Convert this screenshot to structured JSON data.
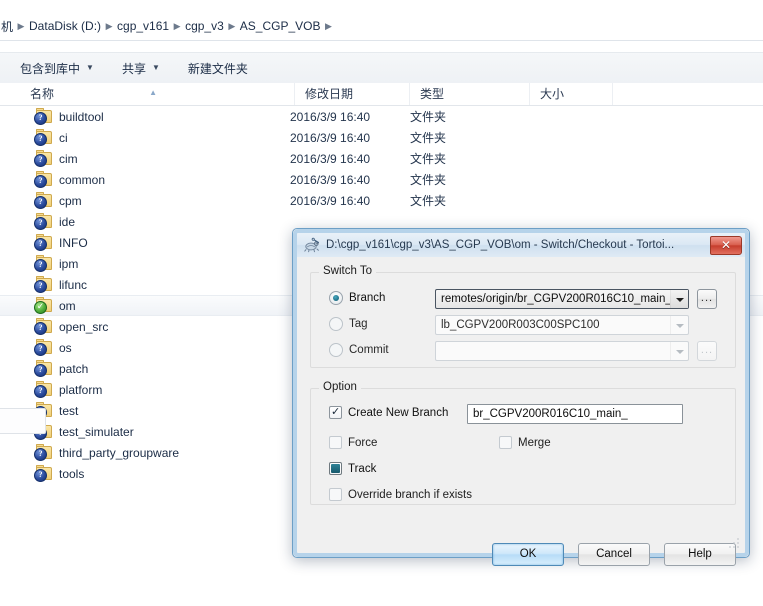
{
  "explorer": {
    "breadcrumb": {
      "items": [
        "机",
        "DataDisk (D:)",
        "cgp_v161",
        "cgp_v3",
        "AS_CGP_VOB"
      ],
      "separator": "▶"
    },
    "toolbar": {
      "items": [
        {
          "label": "包含到库中",
          "caret": "▼"
        },
        {
          "label": "共享",
          "caret": "▼"
        },
        {
          "label": "新建文件夹",
          "caret": ""
        }
      ]
    },
    "columns": [
      {
        "label": "名称",
        "sorted": "▲"
      },
      {
        "label": "修改日期",
        "sorted": ""
      },
      {
        "label": "类型",
        "sorted": ""
      },
      {
        "label": "大小",
        "sorted": ""
      }
    ],
    "rows": [
      {
        "name": "buildtool",
        "date": "2016/3/9 16:40",
        "type": "文件夹",
        "size": "",
        "overlay": "?",
        "selected": false
      },
      {
        "name": "ci",
        "date": "2016/3/9 16:40",
        "type": "文件夹",
        "size": "",
        "overlay": "?",
        "selected": false
      },
      {
        "name": "cim",
        "date": "2016/3/9 16:40",
        "type": "文件夹",
        "size": "",
        "overlay": "?",
        "selected": false
      },
      {
        "name": "common",
        "date": "2016/3/9 16:40",
        "type": "文件夹",
        "size": "",
        "overlay": "?",
        "selected": false
      },
      {
        "name": "cpm",
        "date": "2016/3/9 16:40",
        "type": "文件夹",
        "size": "",
        "overlay": "?",
        "selected": false
      },
      {
        "name": "ide",
        "date": "",
        "type": "",
        "size": "",
        "overlay": "?",
        "selected": false
      },
      {
        "name": "INFO",
        "date": "",
        "type": "",
        "size": "",
        "overlay": "?",
        "selected": false
      },
      {
        "name": "ipm",
        "date": "",
        "type": "",
        "size": "",
        "overlay": "?",
        "selected": false
      },
      {
        "name": "lifunc",
        "date": "",
        "type": "",
        "size": "",
        "overlay": "?",
        "selected": false
      },
      {
        "name": "om",
        "date": "",
        "type": "",
        "size": "",
        "overlay": "✓",
        "selected": true
      },
      {
        "name": "open_src",
        "date": "",
        "type": "",
        "size": "",
        "overlay": "?",
        "selected": false
      },
      {
        "name": "os",
        "date": "",
        "type": "",
        "size": "",
        "overlay": "?",
        "selected": false
      },
      {
        "name": "patch",
        "date": "",
        "type": "",
        "size": "",
        "overlay": "?",
        "selected": false
      },
      {
        "name": "platform",
        "date": "",
        "type": "",
        "size": "",
        "overlay": "?",
        "selected": false
      },
      {
        "name": "test",
        "date": "",
        "type": "",
        "size": "",
        "overlay": "?",
        "selected": false
      },
      {
        "name": "test_simulater",
        "date": "",
        "type": "",
        "size": "",
        "overlay": "?",
        "selected": false
      },
      {
        "name": "third_party_groupware",
        "date": "",
        "type": "",
        "size": "",
        "overlay": "?",
        "selected": false
      },
      {
        "name": "tools",
        "date": "",
        "type": "",
        "size": "",
        "overlay": "?",
        "selected": false
      }
    ]
  },
  "dialog": {
    "title": "D:\\cgp_v161\\cgp_v3\\AS_CGP_VOB\\om - Switch/Checkout - Tortoi...",
    "close_label": "✕",
    "switch_to": {
      "group_label": "Switch To",
      "branch": {
        "radio_label": "Branch",
        "selected": true,
        "value": "remotes/origin/br_CGPV200R016C10_main_",
        "browse_label": "..."
      },
      "tag": {
        "radio_label": "Tag",
        "selected": false,
        "value": "lb_CGPV200R003C00SPC100"
      },
      "commit": {
        "radio_label": "Commit",
        "selected": false,
        "value": "",
        "browse_label": "..."
      }
    },
    "option": {
      "group_label": "Option",
      "create_new_branch": {
        "label": "Create New Branch",
        "state": "checked",
        "value": "br_CGPV200R016C10_main_"
      },
      "force": {
        "label": "Force",
        "state": "unchecked"
      },
      "merge": {
        "label": "Merge",
        "state": "unchecked"
      },
      "track": {
        "label": "Track",
        "state": "mixed"
      },
      "override": {
        "label": "Override branch if exists",
        "state": "unchecked"
      }
    },
    "buttons": {
      "ok": "OK",
      "cancel": "Cancel",
      "help": "Help"
    }
  },
  "colors": {
    "accent": "#16596c",
    "title_bar": "#dbe8f4",
    "close_red": "#c63d2d",
    "default_button": "#b7dcf7"
  }
}
